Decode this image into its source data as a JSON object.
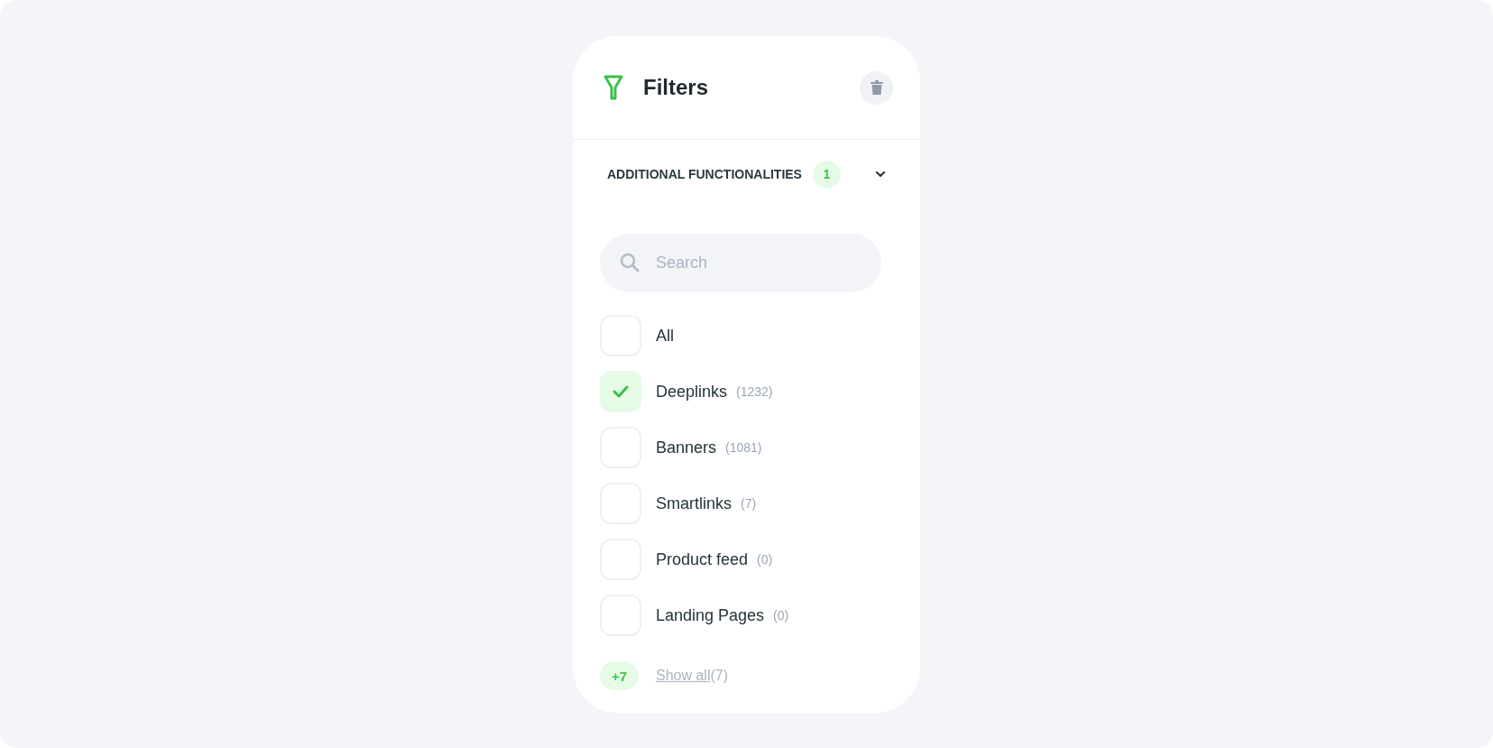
{
  "panel": {
    "title": "Filters"
  },
  "section": {
    "title": "ADDITIONAL FUNCTIONALITIES",
    "badge": "1"
  },
  "search": {
    "placeholder": "Search"
  },
  "options": [
    {
      "label": "All",
      "checked": false
    },
    {
      "label": "Deeplinks",
      "count": "(1232)",
      "checked": true
    },
    {
      "label": "Banners",
      "count": "(1081)",
      "checked": false
    },
    {
      "label": "Smartlinks",
      "count": "(7)",
      "checked": false
    },
    {
      "label": "Product feed",
      "count": "(0)",
      "checked": false
    },
    {
      "label": "Landing Pages",
      "count": "(0)",
      "checked": false
    }
  ],
  "more": {
    "badge": "+7",
    "link": "Show all",
    "count": "(7)"
  }
}
